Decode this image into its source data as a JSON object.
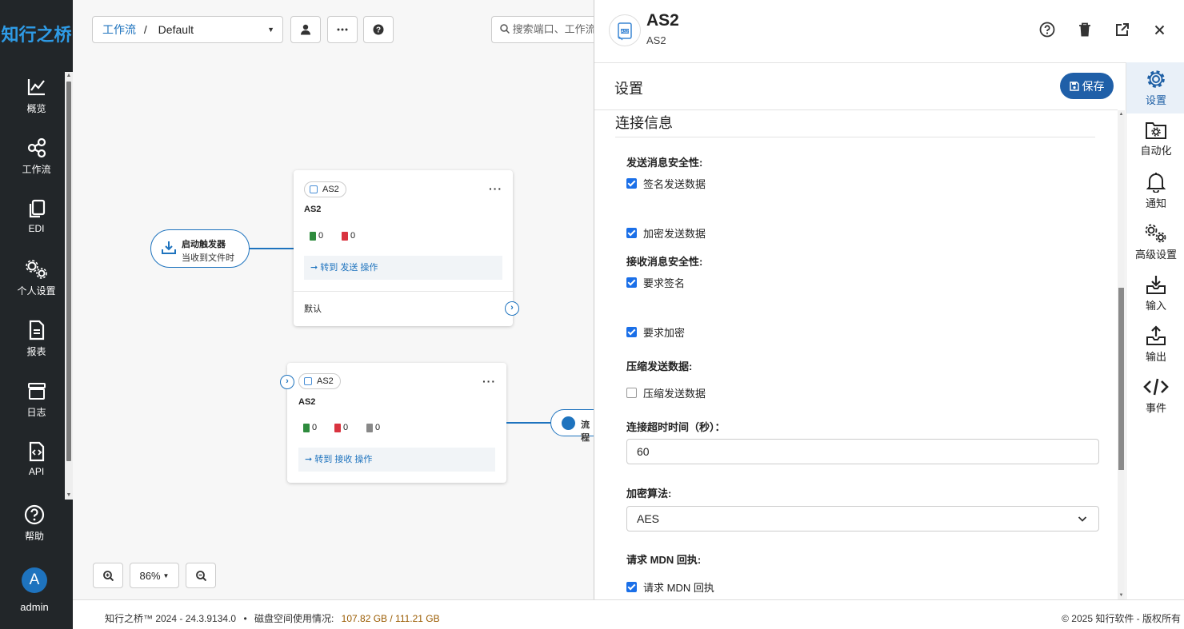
{
  "sidebar": {
    "logo": "知行之桥",
    "items": [
      {
        "label": "概览",
        "icon": "chart-line-icon"
      },
      {
        "label": "工作流",
        "icon": "share-nodes-icon"
      },
      {
        "label": "EDI",
        "icon": "copy-icon"
      },
      {
        "label": "个人设置",
        "icon": "gears-icon"
      },
      {
        "label": "报表",
        "icon": "file-text-icon"
      },
      {
        "label": "日志",
        "icon": "box-icon"
      },
      {
        "label": "API",
        "icon": "file-code-icon"
      },
      {
        "label": "帮助",
        "icon": "question-circle-icon"
      }
    ],
    "avatar_letter": "A",
    "user": "admin"
  },
  "toolbar": {
    "breadcrumb_link": "工作流",
    "breadcrumb_sep": "/",
    "breadcrumb_current": "Default",
    "search_placeholder": "搜索端口、工作流"
  },
  "flow": {
    "trigger": {
      "title": "启动触发器",
      "subtitle": "当收到文件时"
    },
    "card1": {
      "pill": "AS2",
      "title": "AS2",
      "success_count": "0",
      "error_count": "0",
      "goto": "➞ 转到 发送 操作",
      "footer": "默认"
    },
    "card2": {
      "pill": "AS2",
      "title": "AS2",
      "success_count": "0",
      "error_count": "0",
      "pending_count": "0",
      "goto": "➞ 转到 接收 操作"
    },
    "end_node": "流程"
  },
  "zoom": {
    "level": "86%"
  },
  "footer": {
    "version": "知行之桥™ 2024 - 24.3.9134.0",
    "bullet": "•",
    "disk_label": "磁盘空间使用情况:",
    "disk_value": "107.82 GB / 111.21 GB",
    "copyright": "© 2025 知行软件 - 版权所有"
  },
  "panel": {
    "title": "AS2",
    "subtitle": "AS2",
    "settings_title": "设置",
    "save_label": "保存",
    "section": "连接信息",
    "fields": {
      "send_security_label": "发送消息安全性:",
      "sign_send": {
        "label": "签名发送数据",
        "checked": true
      },
      "encrypt_send": {
        "label": "加密发送数据",
        "checked": true
      },
      "recv_security_label": "接收消息安全性:",
      "require_sign": {
        "label": "要求签名",
        "checked": true
      },
      "require_encrypt": {
        "label": "要求加密",
        "checked": true
      },
      "compress_label": "压缩发送数据:",
      "compress": {
        "label": "压缩发送数据",
        "checked": false
      },
      "timeout_label": "连接超时时间（秒）：",
      "timeout_value": "60",
      "algo_label": "加密算法:",
      "algo_value": "AES",
      "mdn_label": "请求 MDN 回执:",
      "mdn": {
        "label": "请求 MDN 回执",
        "checked": true
      }
    },
    "tabs": [
      {
        "label": "设置",
        "icon": "gear-icon"
      },
      {
        "label": "自动化",
        "icon": "folder-gear-icon"
      },
      {
        "label": "通知",
        "icon": "bell-icon"
      },
      {
        "label": "高级设置",
        "icon": "gears-icon"
      },
      {
        "label": "输入",
        "icon": "inbox-in-icon"
      },
      {
        "label": "输出",
        "icon": "inbox-out-icon"
      },
      {
        "label": "事件",
        "icon": "code-icon"
      }
    ]
  },
  "colors": {
    "brand": "#1e73be",
    "sidebar_bg": "#222629",
    "save_btn": "#1f5fa8",
    "checkbox": "#1a6fe8"
  }
}
